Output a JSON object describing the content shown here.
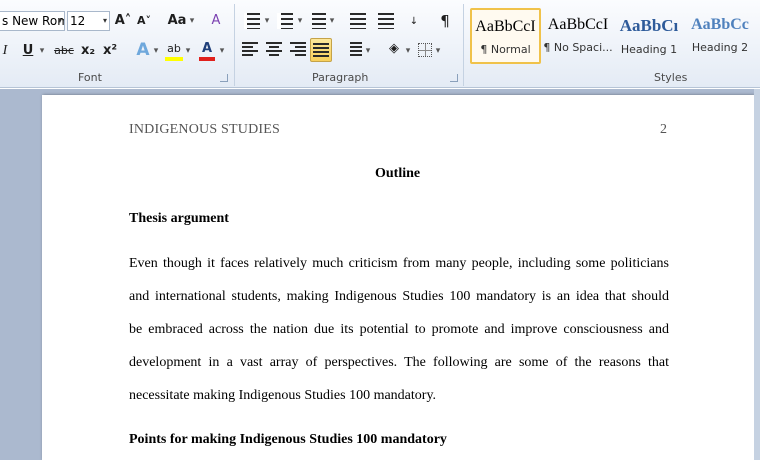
{
  "ribbon": {
    "font_group_label": "Font",
    "paragraph_group_label": "Paragraph",
    "styles_group_label": "Styles",
    "font_name": "s New Rom",
    "font_size": "12",
    "grow_font": "A˄",
    "shrink_font": "A˅",
    "change_case": "Aa",
    "clear_format": "A",
    "italic": "I",
    "underline": "U",
    "strikethrough": "abc",
    "subscript": "x₂",
    "superscript": "x²",
    "text_effects": "A",
    "highlight": "ab",
    "font_color": "A",
    "show_marks": "¶",
    "dropdown_arrow": "▾",
    "styles": [
      {
        "preview": "AaBbCcI",
        "name": "¶ Normal",
        "color": "#000000"
      },
      {
        "preview": "AaBbCcI",
        "name": "¶ No Spaci...",
        "color": "#000000"
      },
      {
        "preview": "AaBbCı",
        "name": "Heading 1",
        "color": "#2e5b9a"
      },
      {
        "preview": "AaBbCc",
        "name": "Heading 2",
        "color": "#4f81bd"
      }
    ],
    "colors": {
      "accent_highlight": "#f8cf5a",
      "font_color_bar": "#e0201c",
      "highlight_bar": "#ffff00"
    }
  },
  "document": {
    "header_left": "INDIGENOUS STUDIES",
    "header_page": "2",
    "title": "Outline",
    "thesis_heading": "Thesis argument",
    "paragraph_lines": [
      "Even though it faces relatively much criticism from many people, including some politicians",
      "and international students, making Indigenous Studies 100 mandatory is an idea that should",
      "be embraced across the nation due its potential to promote and improve consciousness and",
      "development in a vast array of perspectives. The following are some of the reasons that",
      "necessitate making Indigenous Studies 100 mandatory."
    ],
    "points_heading": "Points for making Indigenous Studies 100 mandatory"
  }
}
